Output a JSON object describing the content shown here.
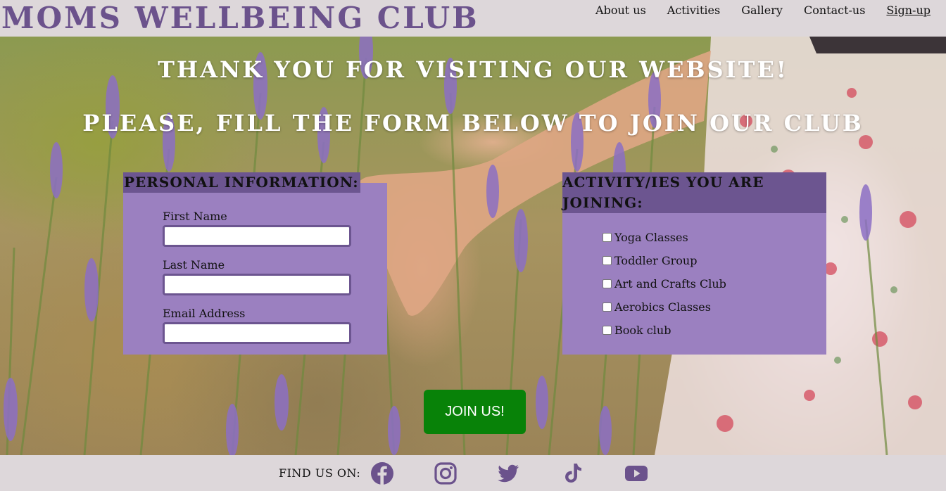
{
  "brand": {
    "title": "MOMS WELLBEING CLUB",
    "color": "#6b528c"
  },
  "nav": {
    "items": [
      {
        "label": "About us"
      },
      {
        "label": "Activities"
      },
      {
        "label": "Gallery"
      },
      {
        "label": "Contact-us"
      },
      {
        "label": "Sign-up",
        "active": true
      }
    ]
  },
  "hero": {
    "heading": "THANK YOU FOR VISITING OUR WEBSITE!",
    "subheading": "PLEASE, FILL THE FORM BELOW TO JOIN OUR CLUB"
  },
  "personal": {
    "legend": "PERSONAL INFORMATION:",
    "fields": [
      {
        "label": "First Name",
        "value": ""
      },
      {
        "label": "Last Name",
        "value": ""
      },
      {
        "label": "Email Address",
        "value": ""
      }
    ]
  },
  "activities": {
    "legend": "ACTIVITY/IES YOU ARE JOINING:",
    "options": [
      {
        "label": "Yoga Classes",
        "checked": false
      },
      {
        "label": "Toddler Group",
        "checked": false
      },
      {
        "label": "Art and Crafts Club",
        "checked": false
      },
      {
        "label": "Aerobics Classes",
        "checked": false
      },
      {
        "label": "Book club",
        "checked": false
      }
    ]
  },
  "join_button": {
    "label": "JOIN US!",
    "color": "#088208"
  },
  "footer": {
    "find_label": "FIND US ON:",
    "socials": [
      {
        "icon": "facebook-icon"
      },
      {
        "icon": "instagram-icon"
      },
      {
        "icon": "twitter-icon"
      },
      {
        "icon": "tiktok-icon"
      },
      {
        "icon": "youtube-icon"
      }
    ],
    "icon_color": "#6b528c"
  },
  "colors": {
    "panel": "#9b80c0",
    "legend_bg": "#6c5590",
    "header_bg": "#ddd7da"
  }
}
